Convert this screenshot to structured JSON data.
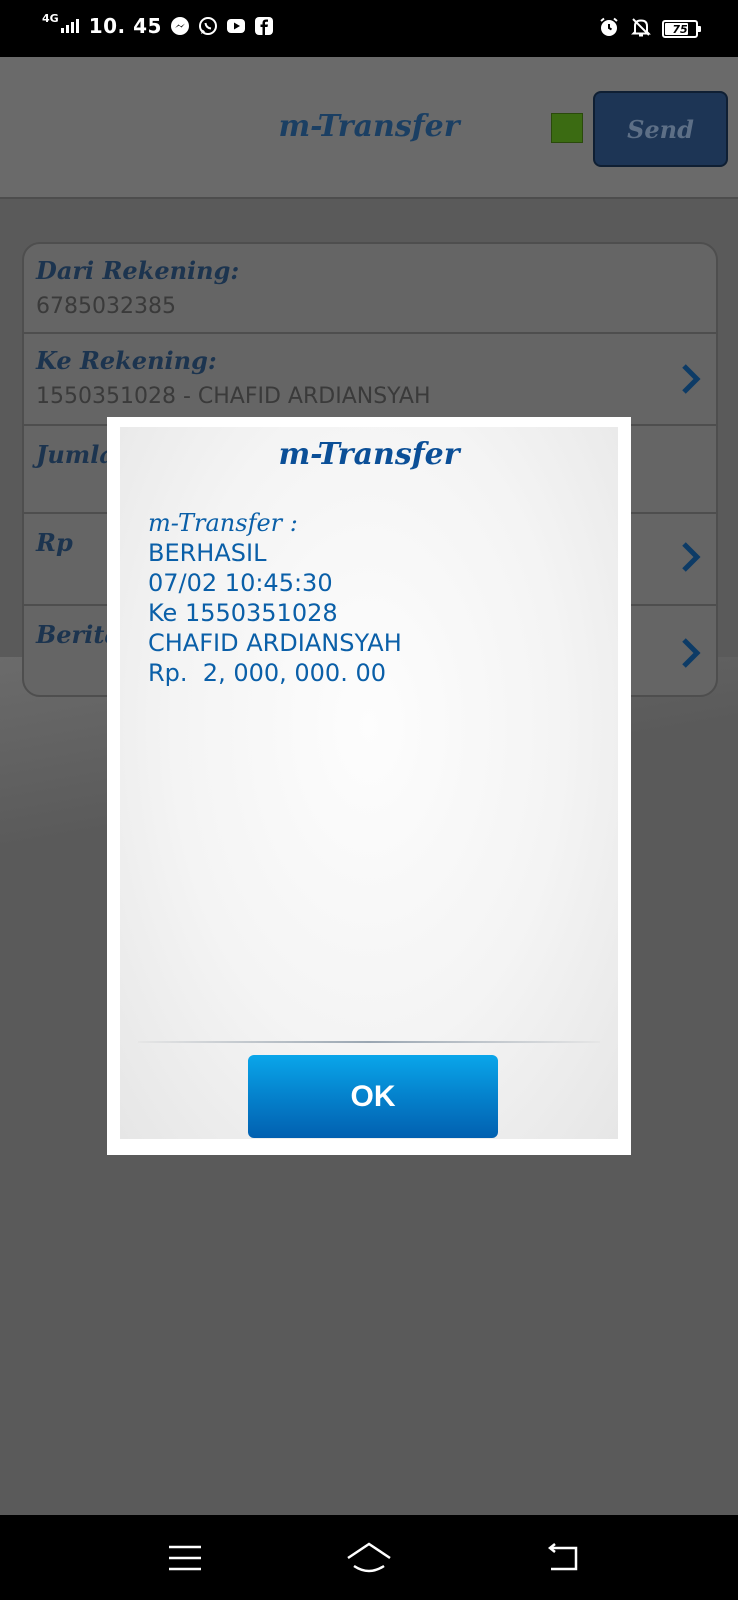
{
  "status_bar": {
    "network": "4G",
    "time": "10. 45",
    "battery": "75",
    "app_icons": [
      "messenger-icon",
      "whatsapp-icon",
      "youtube-icon",
      "facebook-icon"
    ],
    "right_icons": [
      "alarm-icon",
      "notifications-off-icon",
      "battery-icon"
    ]
  },
  "header": {
    "title": "m-Transfer",
    "send_label": "Send",
    "status_color": "#3b6b12"
  },
  "form": {
    "rows": [
      {
        "label": "Dari Rekening:",
        "value": "6785032385"
      },
      {
        "label": "Ke Rekening:",
        "value": "1550351028 - CHAFID ARDIANSYAH"
      },
      {
        "label": "Jumla",
        "value": ""
      },
      {
        "label": "Rp",
        "value": ""
      },
      {
        "label": "Berita",
        "value": ""
      }
    ]
  },
  "dialog": {
    "title": "m-Transfer",
    "message_lines": [
      "m-Transfer :",
      "BERHASIL",
      "07/02 10:45:30",
      "Ke 1550351028",
      "CHAFID ARDIANSYAH",
      "Rp.  2, 000, 000. 00"
    ],
    "ok_label": "OK"
  },
  "nav_bar": {
    "buttons": [
      "menu-icon",
      "home-icon",
      "back-icon"
    ]
  },
  "colors": {
    "accent_blue": "#0a5fa8",
    "ok_button": "#0585cf",
    "overlay_bg": "#575757"
  }
}
